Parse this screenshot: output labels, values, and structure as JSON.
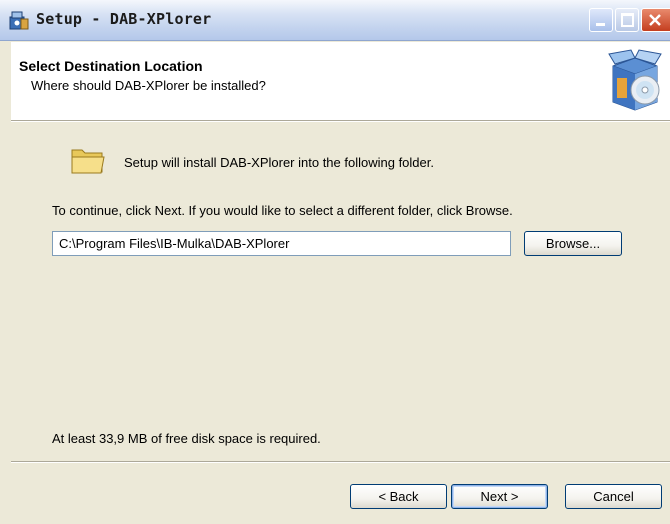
{
  "window": {
    "title": "Setup - DAB-XPlorer"
  },
  "titlebar_buttons": {
    "minimize_icon": "minimize-icon",
    "maximize_icon": "maximize-icon",
    "close_icon": "close-icon"
  },
  "header": {
    "title": "Select Destination Location",
    "subtitle": "Where should DAB-XPlorer be installed?",
    "image_icon": "setup-cd-box-icon"
  },
  "body": {
    "folder_icon": "folder-icon",
    "intro": "Setup will install DAB-XPlorer into the following folder.",
    "continue_text": "To continue, click Next. If you would like to select a different folder, click Browse.",
    "path_value": "C:\\Program Files\\IB-Mulka\\DAB-XPlorer",
    "browse_label": "Browse...",
    "disk_space": "At least 33,9 MB of free disk space is required."
  },
  "footer": {
    "back_label": "< Back",
    "next_label": "Next >",
    "cancel_label": "Cancel"
  },
  "colors": {
    "dialog_bg": "#ece9d8",
    "header_bg": "#ffffff",
    "button_border": "#003c74",
    "close_button": "#c43e1f"
  }
}
